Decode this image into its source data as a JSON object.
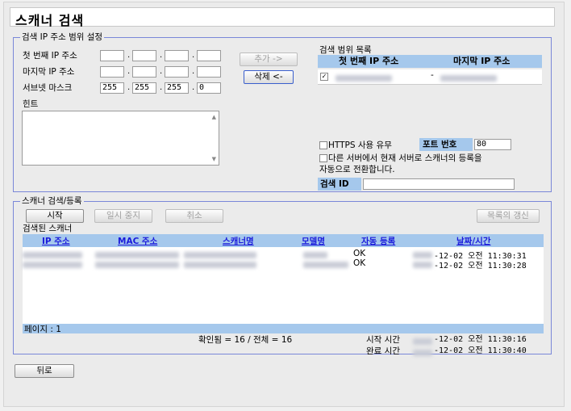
{
  "title": "스캐너 검색",
  "range_settings": {
    "legend": "검색 IP 주소 범위 설정",
    "first_ip_label": "첫 번째 IP 주소",
    "last_ip_label": "마지막 IP 주소",
    "subnet_label": "서브넷 마스크",
    "subnet_values": [
      "255",
      "255",
      "255",
      "0"
    ],
    "add_button": "추가 ->",
    "delete_button": "삭제 <-",
    "hint_label": "힌트"
  },
  "range_list": {
    "label": "검색 범위 목록",
    "col_first": "첫 번째 IP 주소",
    "col_last": "마지막 IP 주소",
    "row_checked": true,
    "row_separator": "-"
  },
  "options": {
    "https_label": "HTTPS 사용 유무",
    "https_checked": false,
    "port_label": "포트 번호",
    "port_value": "80",
    "transfer_label_line1": "다른 서버에서 현재 서버로 스캐너의 등록을",
    "transfer_label_line2": "자동으로 전환합니다.",
    "transfer_checked": false,
    "search_id_label": "검색 ID",
    "search_id_value": ""
  },
  "scan": {
    "legend": "스캐너 검색/등록",
    "start_button": "시작",
    "pause_button": "일시 중지",
    "cancel_button": "취소",
    "refresh_button": "목록의 갱신",
    "found_label": "검색된 스캐너",
    "columns": [
      "IP 주소",
      "MAC 주소",
      "스캐너명",
      "모델명",
      "자동 등록",
      "날짜/시간"
    ],
    "rows": [
      {
        "auto": "OK",
        "datetime": "-12-02 오전 11:30:31"
      },
      {
        "auto": "OK",
        "datetime": "-12-02 오전 11:30:28"
      }
    ],
    "page_label": "페이지 : 1",
    "confirmed": "확인됨 = 16 / 전체 = 16",
    "start_time_label": "시작 시간",
    "start_time": "-12-02 오전 11:30:16",
    "end_time_label": "완료 시간",
    "end_time": "-12-02 오전 11:30:40"
  },
  "back_button": "뒤로"
}
